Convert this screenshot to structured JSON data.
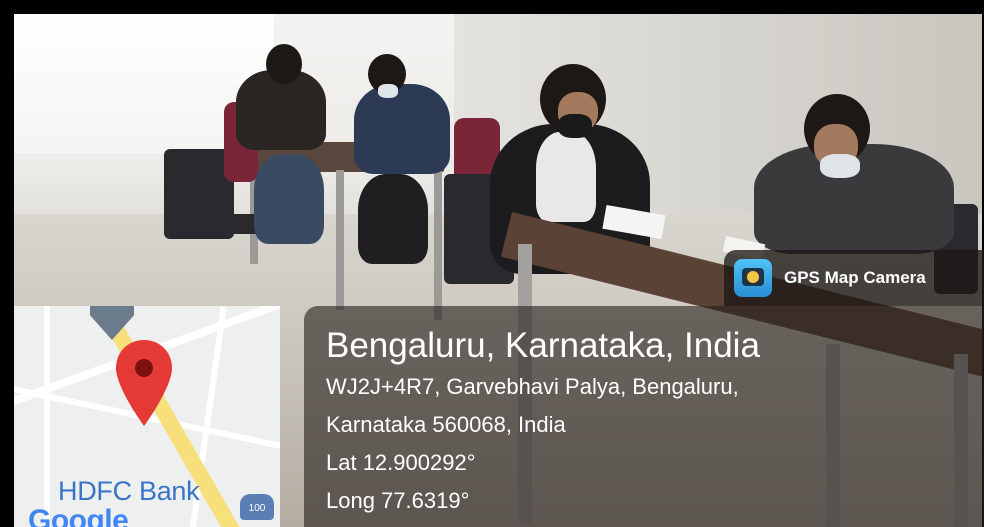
{
  "photo": {
    "subject": ""
  },
  "map": {
    "place_label": "HDFC Bank",
    "brand_label": "Google",
    "bank_icon_text": "100"
  },
  "location": {
    "title": "Bengaluru, Karnataka, India",
    "address_line1": "WJ2J+4R7, Garvebhavi Palya, Bengaluru,",
    "address_line2": "Karnataka 560068, India",
    "lat": "Lat 12.900292°",
    "long": "Long 77.6319°"
  },
  "badge": {
    "label": "GPS Map Camera",
    "icon": "gps-camera-app-icon"
  },
  "colors": {
    "pin_red": "#e53935",
    "overlay": "#28221e",
    "google_blue": "#4285f4"
  }
}
